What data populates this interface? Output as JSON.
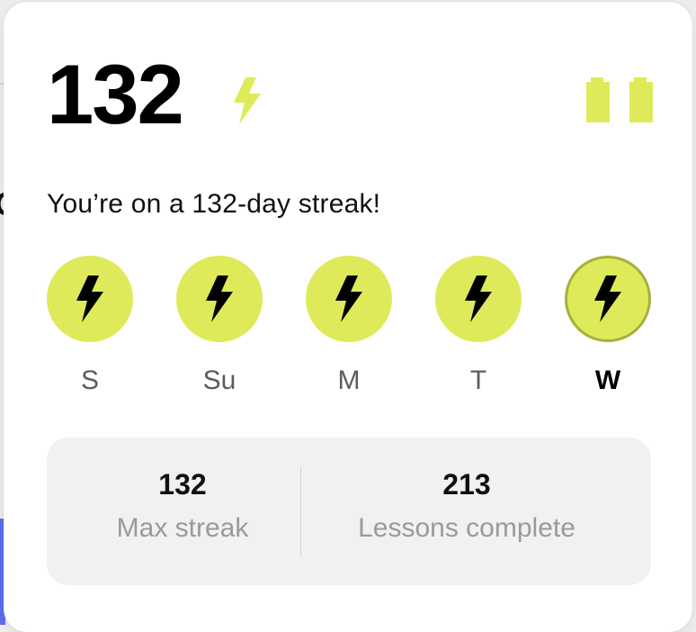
{
  "colors": {
    "accent": "#dfea5a",
    "accent_border": "#a6b03a",
    "bolt_dark": "#000000",
    "panel_bg": "#f1f1f1",
    "muted_text": "#9a9a9a"
  },
  "header": {
    "streak_count": "132",
    "streak_icon": "lightning-bolt-icon",
    "status_icon": "battery-icon"
  },
  "streak_message": "You’re on a 132-day streak!",
  "week": {
    "days": [
      {
        "label": "S",
        "icon": "lightning-bolt-icon",
        "completed": true,
        "current": false
      },
      {
        "label": "Su",
        "icon": "lightning-bolt-icon",
        "completed": true,
        "current": false
      },
      {
        "label": "M",
        "icon": "lightning-bolt-icon",
        "completed": true,
        "current": false
      },
      {
        "label": "T",
        "icon": "lightning-bolt-icon",
        "completed": true,
        "current": false
      },
      {
        "label": "W",
        "icon": "lightning-bolt-icon",
        "completed": true,
        "current": true
      }
    ]
  },
  "stats": {
    "max_streak": {
      "value": "132",
      "label": "Max streak"
    },
    "lessons_complete": {
      "value": "213",
      "label": "Lessons complete"
    }
  }
}
